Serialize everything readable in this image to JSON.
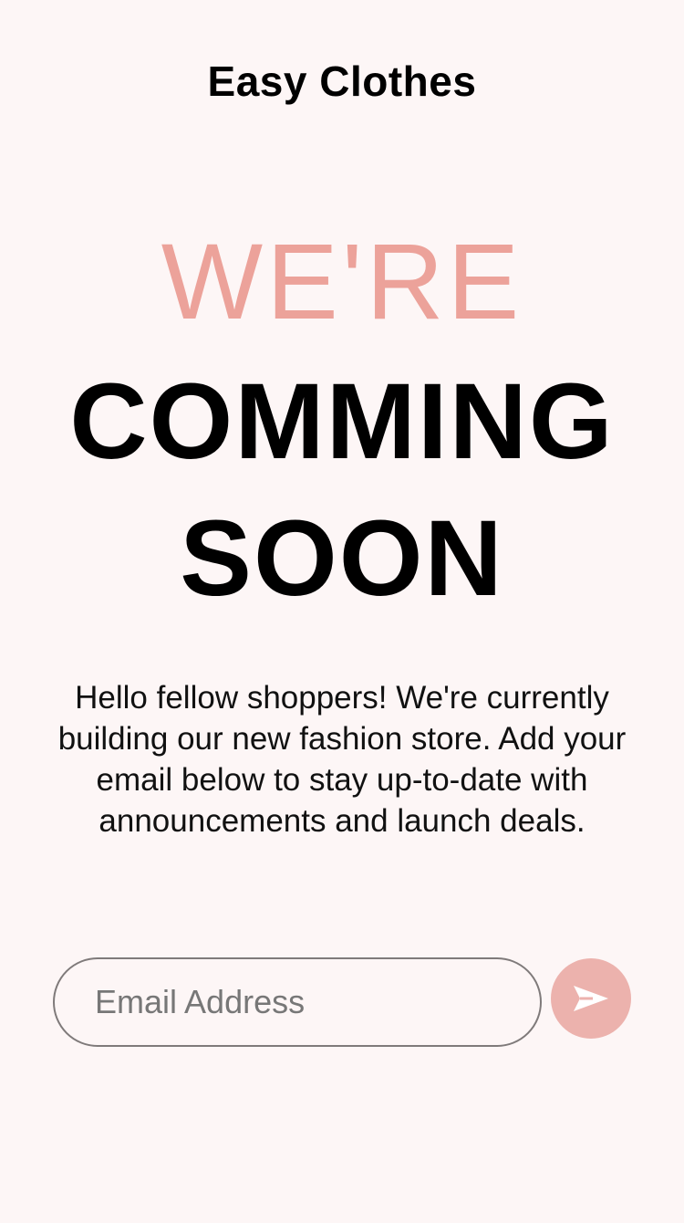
{
  "brand": {
    "name": "Easy Clothes"
  },
  "headline": {
    "line1": "WE'RE",
    "line2": "COMMING",
    "line3": "SOON"
  },
  "message": {
    "text": "Hello fellow shoppers! We're currently building our new fashion store. Add your email below to stay up-to-date with announcements and launch deals."
  },
  "signup": {
    "email_placeholder": "Email Address",
    "email_value": "",
    "submit_icon": "send-arrow-icon"
  },
  "colors": {
    "background": "#fdf6f6",
    "accent": "#eca29a",
    "button": "#ecb2ad",
    "text": "#000000"
  }
}
